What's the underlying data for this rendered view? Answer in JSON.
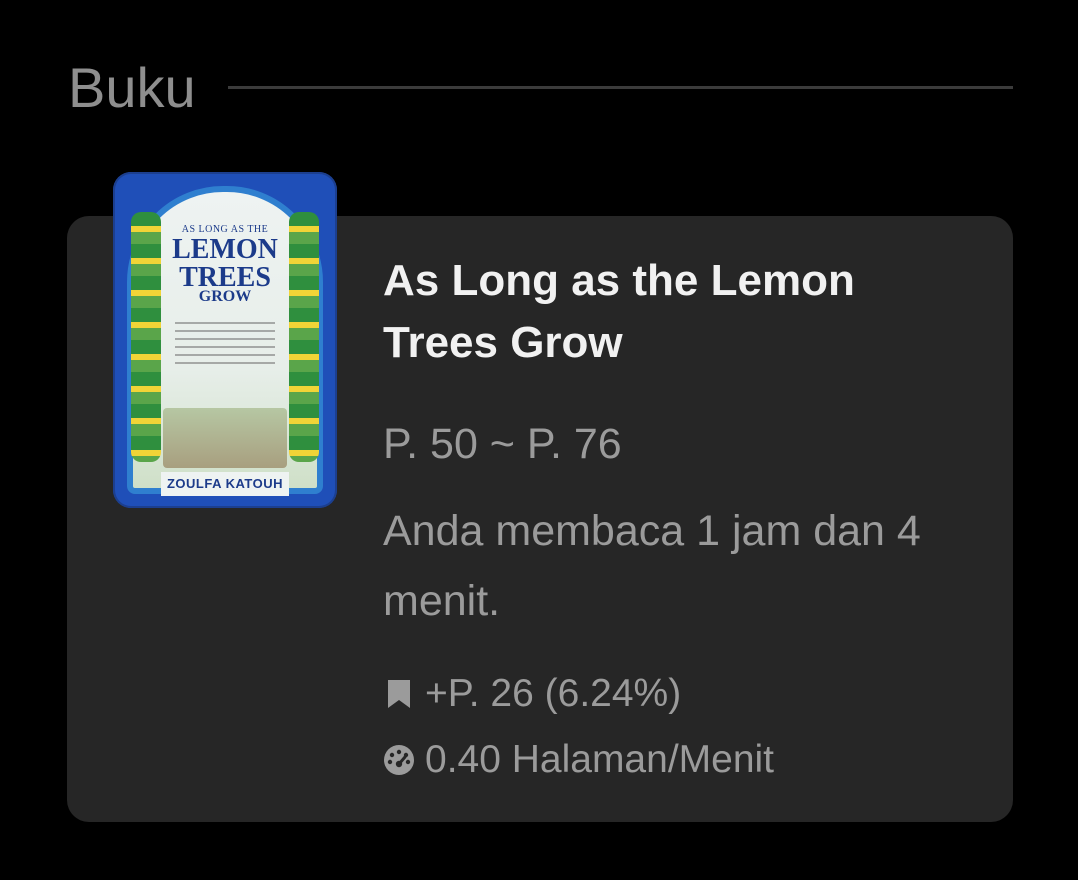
{
  "section": {
    "title": "Buku"
  },
  "book": {
    "cover": {
      "title_small": "AS LONG AS THE",
      "title_big_1": "LEMON",
      "title_big_2": "TREES",
      "title_grow": "GROW",
      "author": "ZOULFA KATOUH"
    },
    "title": "As Long as the Lemon Trees Grow",
    "page_range": "P. 50 ~ P. 76",
    "duration": "Anda membaca 1 jam dan 4 menit.",
    "stats": [
      {
        "icon": "bookmark-icon",
        "text": "+P. 26 (6.24%)"
      },
      {
        "icon": "speedometer-icon",
        "text": "0.40 Halaman/Menit"
      }
    ]
  },
  "colors": {
    "background": "#000000",
    "card": "#262626",
    "title": "#f1f1f1",
    "muted": "#9b9b9b"
  }
}
